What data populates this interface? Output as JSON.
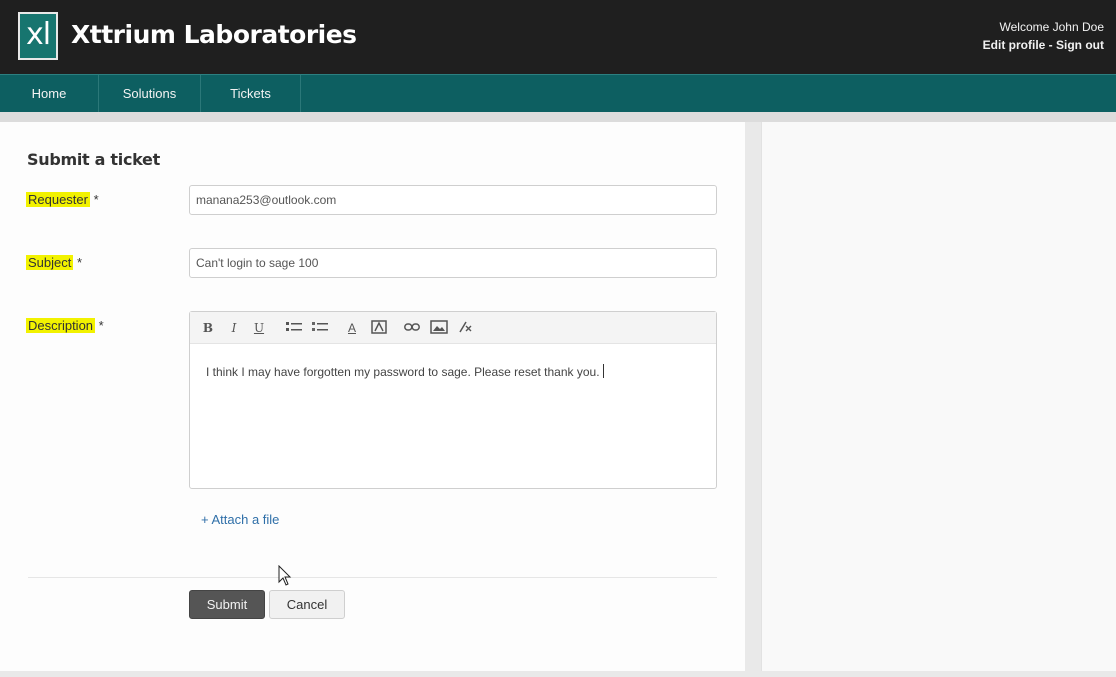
{
  "header": {
    "logo_text": "xl",
    "brand": "Xttrium Laboratories",
    "welcome": "Welcome John Doe",
    "edit_profile": "Edit profile",
    "separator": " - ",
    "sign_out": "Sign out"
  },
  "nav": {
    "items": [
      {
        "label": "Home"
      },
      {
        "label": "Solutions"
      },
      {
        "label": "Tickets"
      }
    ]
  },
  "form": {
    "title": "Submit a ticket",
    "requester_label": "Requester",
    "subject_label": "Subject",
    "description_label": "Description",
    "required_mark": "*",
    "requester_value": "manana253@outlook.com",
    "subject_value": "Can't login to sage 100",
    "description_value": "I think I may have forgotten my password to sage. Please reset thank you.",
    "attach_label": "+ Attach a file",
    "submit_label": "Submit",
    "cancel_label": "Cancel"
  },
  "toolbar": {
    "bold": "B",
    "italic": "I",
    "underline": "U",
    "text_color": "A",
    "icons": [
      "bold-icon",
      "italic-icon",
      "underline-icon",
      "bulleted-list-icon",
      "numbered-list-icon",
      "text-color-icon",
      "background-color-icon",
      "link-icon",
      "image-icon",
      "clear-format-icon"
    ]
  },
  "colors": {
    "topbar": "#1f1f1f",
    "navbar": "#0d5f61",
    "logo": "#17756f",
    "highlight": "#f2f200",
    "link": "#2f6fa8"
  }
}
